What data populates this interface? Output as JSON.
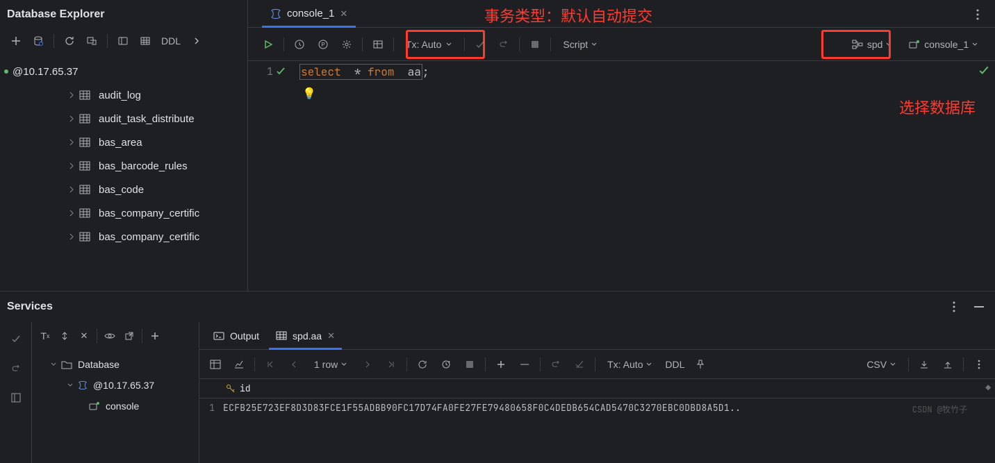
{
  "panel": {
    "title": "Database Explorer"
  },
  "tree": {
    "root": "@10.17.65.37",
    "items": [
      "audit_log",
      "audit_task_distribute",
      "bas_area",
      "bas_barcode_rules",
      "bas_code",
      "bas_company_certific",
      "bas_company_certific"
    ]
  },
  "ddl": "DDL",
  "tab": {
    "name": "console_1"
  },
  "annotations": {
    "tx_note": "事务类型：默认自动提交",
    "db_note": "选择数据库"
  },
  "editor": {
    "line_no": "1",
    "code": {
      "k1": "select",
      "star": "*",
      "k2": "from",
      "id": "aa",
      "semi": ";"
    },
    "tx_label": "Tx: Auto",
    "script_label": "Script",
    "schema": "spd",
    "console": "console_1"
  },
  "services": {
    "title": "Services",
    "tabs": {
      "output": "Output",
      "tab2": "spd.aa"
    },
    "rows_label": "1 row",
    "tx_label": "Tx: Auto",
    "ddl": "DDL",
    "csv": "CSV",
    "tree": {
      "root": "Database",
      "host": "@10.17.65.37",
      "console": "console"
    },
    "grid": {
      "col": "id",
      "row_no": "1",
      "val": "ECFB25E723EF8D3D83FCE1F55ADBB90FC17D74FA0FE27FE79480658F0C4DEDB654CAD5470C3270EBC0DBD8A5D1.."
    }
  },
  "watermark": "CSDN @牧竹子"
}
